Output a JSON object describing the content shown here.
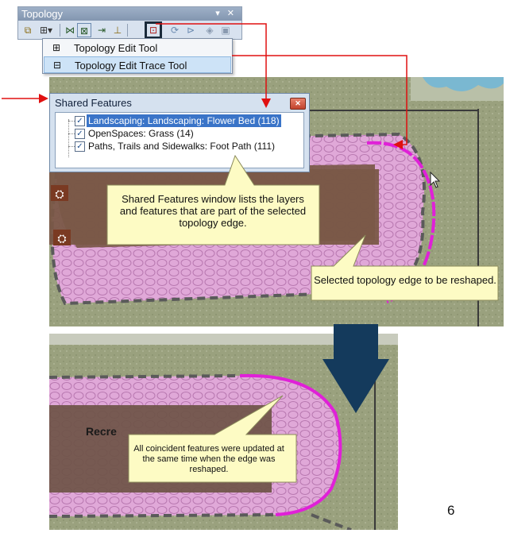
{
  "toolbar": {
    "title": "Topology",
    "window_controls": "▾ ✕"
  },
  "menu": {
    "items": [
      {
        "icon": "topology-edit-icon",
        "label": "Topology Edit Tool"
      },
      {
        "icon": "topology-edit-trace-icon",
        "label": "Topology Edit Trace Tool"
      }
    ]
  },
  "shared_features": {
    "title": "Shared Features",
    "items": [
      {
        "label": "Landscaping: Landscaping: Flower Bed (118)",
        "checked": true,
        "selected": true
      },
      {
        "label": "OpenSpaces: Grass (14)",
        "checked": true,
        "selected": false
      },
      {
        "label": "Paths, Trails and Sidewalks: Foot Path (111)",
        "checked": true,
        "selected": false
      }
    ]
  },
  "callouts": {
    "shared_features_note": "Shared Features window lists the layers and features that are part of the selected topology edge.",
    "edge_note": "Selected topology edge to be reshaped.",
    "result_note": "All coincident features were updated at the same time when the edge was reshaped."
  },
  "map_label": "Recre",
  "page_number": "6",
  "colors": {
    "highlight_edge": "#e020d8",
    "arrow_red": "#e01010",
    "callout_fill": "#fdfbc4",
    "big_arrow": "#143a5c"
  }
}
